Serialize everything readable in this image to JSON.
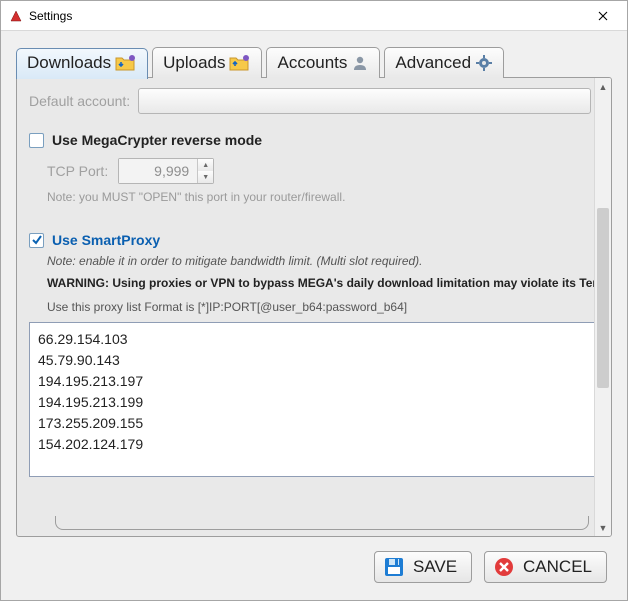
{
  "window": {
    "title": "Settings"
  },
  "tabs": {
    "downloads": "Downloads",
    "uploads": "Uploads",
    "accounts": "Accounts",
    "advanced": "Advanced"
  },
  "content": {
    "default_account_label": "Default account:",
    "mega_reverse_label": "Use MegaCrypter reverse mode",
    "tcp_port_label": "TCP Port:",
    "tcp_port_value": "9,999",
    "port_note": "Note: you MUST \"OPEN\" this port in your router/firewall.",
    "smartproxy_label": "Use SmartProxy",
    "smartproxy_note": "Note: enable it in order to mitigate bandwidth limit. (Multi slot required).",
    "smartproxy_warning": "WARNING: Using proxies or VPN to bypass MEGA's daily download limitation may violate its Terms of Use. USE TH",
    "proxy_format": "Use this proxy list Format is [*]IP:PORT[@user_b64:password_b64]",
    "proxy_list": "66.29.154.103\n45.79.90.143\n194.195.213.197\n194.195.213.199\n173.255.209.155\n154.202.124.179"
  },
  "footer": {
    "save": "SAVE",
    "cancel": "CANCEL"
  }
}
